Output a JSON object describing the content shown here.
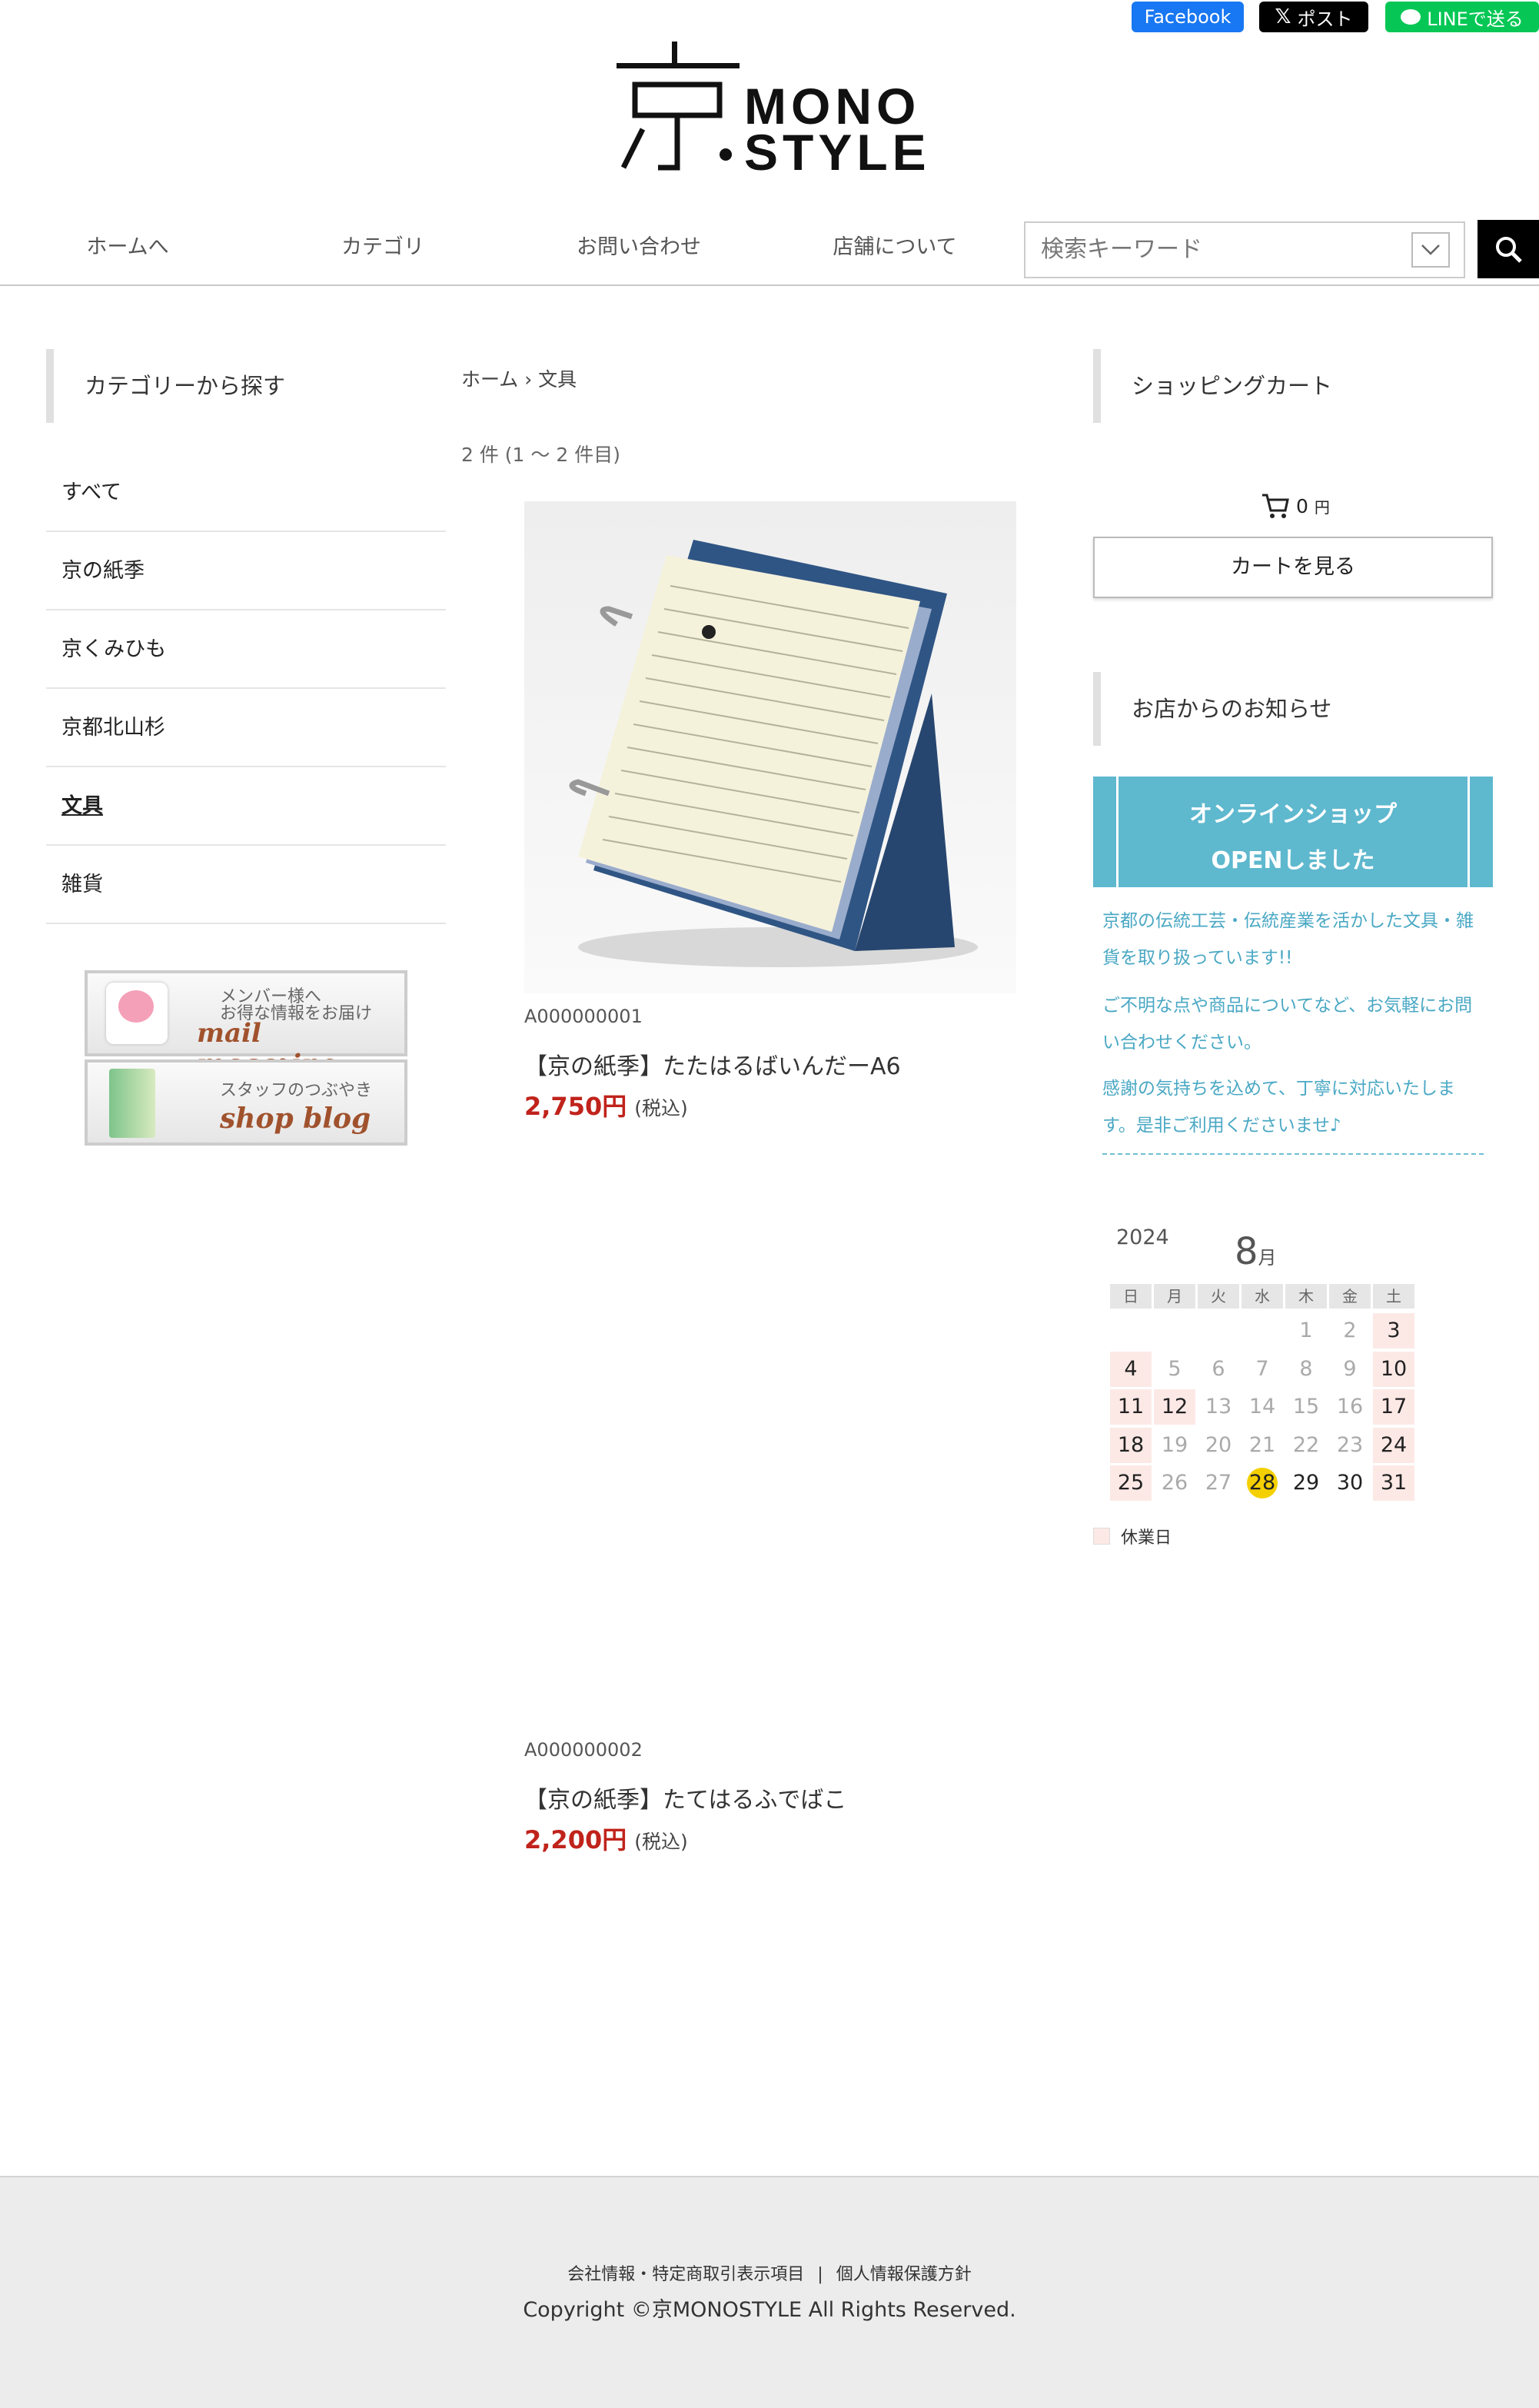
{
  "social": {
    "facebook": "Facebook",
    "x_post": "ポスト",
    "line": "LINEで送る"
  },
  "logo": {
    "kanji": "京",
    "line1": "MONO",
    "line2": "STYLE"
  },
  "nav": {
    "items": [
      "ホームへ",
      "カテゴリ",
      "お問い合わせ",
      "店舗について"
    ],
    "search_placeholder": "検索キーワード"
  },
  "sidebar": {
    "heading": "カテゴリーから探す",
    "categories": [
      "すべて",
      "京の紙季",
      "京くみひも",
      "京都北山杉",
      "文具",
      "雑貨"
    ],
    "active_index": 4,
    "banners": [
      {
        "line1": "メンバー様へ",
        "line2": "お得な情報をお届け",
        "line3": "mail magazine"
      },
      {
        "line1": "スタッフのつぶやき",
        "line2": "shop blog"
      }
    ]
  },
  "main": {
    "breadcrumb": {
      "home": "ホーム",
      "sep": "›",
      "current": "文具"
    },
    "count_text": "2 件 (1 〜 2 件目)",
    "products": [
      {
        "code": "A000000001",
        "name": "【京の紙季】たたはるばいんだーA6",
        "price": "2,750円",
        "tax": "(税込)"
      },
      {
        "code": "A000000002",
        "name": "【京の紙季】たてはるふでばこ",
        "price": "2,200円",
        "tax": "(税込)"
      }
    ]
  },
  "right": {
    "cart_heading": "ショッピングカート",
    "cart_total": "0",
    "cart_currency": "円",
    "cart_button": "カートを見る",
    "news_heading": "お店からのお知らせ",
    "news_banner": {
      "line1": "オンラインショップ",
      "line2": "OPENしました"
    },
    "news_paragraphs": [
      "京都の伝統工芸・伝統産業を活かした文具・雑貨を取り扱っています!!",
      "ご不明な点や商品についてなど、お気軽にお問い合わせください。",
      "感謝の気持ちを込めて、丁寧に対応いたします。是非ご利用くださいませ♪"
    ],
    "calendar": {
      "year": "2024",
      "month": "8",
      "month_suffix": "月",
      "weekdays": [
        "日",
        "月",
        "火",
        "水",
        "木",
        "金",
        "土"
      ],
      "first_weekday": 4,
      "days_in_month": 31,
      "closed_days": [
        3,
        4,
        10,
        11,
        12,
        17,
        18,
        24,
        25,
        31
      ],
      "today": 28,
      "legend": "休業日"
    }
  },
  "footer": {
    "link1": "会社情報・特定商取引表示項目",
    "sep": "|",
    "link2": "個人情報保護方針",
    "copyright": "Copyright ©京MONOSTYLE All Rights Reserved."
  },
  "colors": {
    "accent": "#5eb8ce",
    "price": "#c0231b",
    "closed": "#fce9e6",
    "today": "#f5d000",
    "facebook": "#1877f2",
    "line": "#06c755"
  }
}
